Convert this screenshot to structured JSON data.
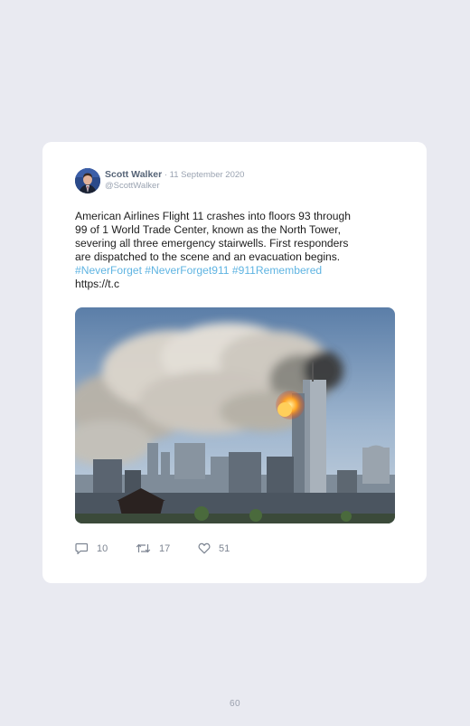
{
  "tweet": {
    "author_name": "Scott Walker",
    "separator": " · ",
    "date": "11 September 2020",
    "handle": "@ScottWalker",
    "text_lines": [
      "American Airlines Flight 11 crashes into floors 93 through",
      "99 of 1 World Trade Center, known as the North Tower,",
      "severing all three emergency stairwells. First responders",
      "are dispatched to the scene and an evacuation begins."
    ],
    "hashtags": "#NeverForget #NeverForget911 #911Remembered",
    "link": "https://t.c",
    "image_alt": "Photo of smoke rising from the North Tower of the World Trade Center skyline",
    "counts": {
      "replies": "10",
      "retweets": "17",
      "likes": "51"
    }
  },
  "icons": {
    "reply": "speech-bubble-icon",
    "retweet": "retweet-icon",
    "like": "heart-icon"
  },
  "colors": {
    "background": "#e9eaf1",
    "card": "#ffffff",
    "hashtag": "#5fb4e2",
    "muted": "#9aa3b1"
  },
  "page_number": "60"
}
